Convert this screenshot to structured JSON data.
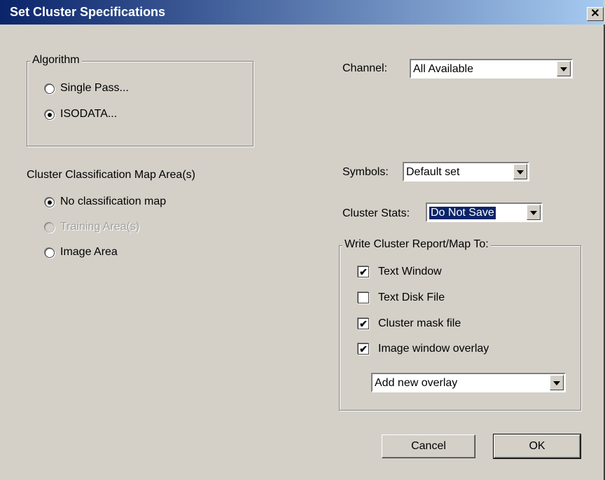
{
  "window": {
    "title": "Set Cluster Specifications",
    "close_glyph": "✕"
  },
  "algorithm": {
    "legend": "Algorithm",
    "options": [
      {
        "label": "Single Pass...",
        "checked": false
      },
      {
        "label": "ISODATA...",
        "checked": true
      }
    ]
  },
  "map_area": {
    "heading": "Cluster Classification Map Area(s)",
    "options": [
      {
        "label": "No classification map",
        "checked": true,
        "disabled": false
      },
      {
        "label": "Training Area(s)",
        "checked": false,
        "disabled": true
      },
      {
        "label": "Image Area",
        "checked": false,
        "disabled": false
      }
    ]
  },
  "channel": {
    "label": "Channel:",
    "value": "All Available"
  },
  "symbols": {
    "label": "Symbols:",
    "value": "Default set"
  },
  "cluster_stats": {
    "label": "Cluster Stats:",
    "value": "Do Not Save"
  },
  "report": {
    "legend": "Write Cluster Report/Map To:",
    "options": [
      {
        "label": "Text Window",
        "checked": true
      },
      {
        "label": "Text Disk File",
        "checked": false
      },
      {
        "label": "Cluster mask file",
        "checked": true
      },
      {
        "label": "Image window overlay",
        "checked": true
      }
    ],
    "overlay_select": "Add new overlay"
  },
  "buttons": {
    "cancel": "Cancel",
    "ok": "OK"
  },
  "icons": {
    "check": "✔",
    "close": "close-icon",
    "dropdown": "chevron-down-icon"
  }
}
